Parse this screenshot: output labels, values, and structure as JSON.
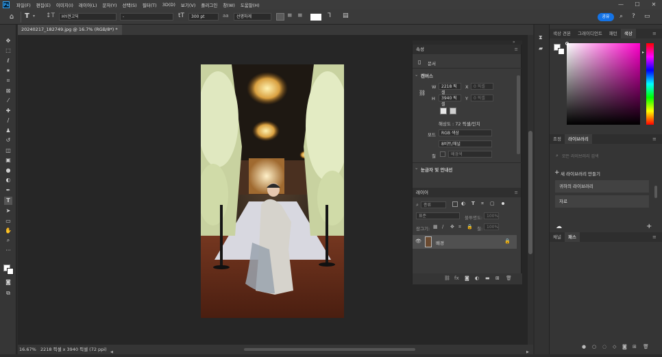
{
  "menubar": {
    "logo": "Ps",
    "items": [
      "파일(F)",
      "편집(E)",
      "이미지(I)",
      "레이어(L)",
      "문자(Y)",
      "선택(S)",
      "필터(T)",
      "3D(D)",
      "보기(V)",
      "플러그인",
      "창(W)",
      "도움말(H)"
    ]
  },
  "options": {
    "font_family": "HY견고딕",
    "font_style": "-",
    "font_size": "300 pt",
    "antialias": "선명하게",
    "share_label": "공유"
  },
  "document": {
    "tab_title": "20240217_182749.jpg @ 16.7% (RGB/8*) *",
    "zoom": "16.67%",
    "status": "2218 픽셀 x 3940 픽셀 (72 ppi)"
  },
  "properties": {
    "title": "속성",
    "doc_label": "문서",
    "canvas_section": "캔버스",
    "w_label": "W",
    "w_value": "2218 픽셀",
    "h_label": "H",
    "h_value": "3940 픽셀",
    "x_label": "X",
    "x_value": "0 픽셀",
    "y_label": "Y",
    "y_value": "0 픽셀",
    "resolution": "해상도 : 72 픽셀/인치",
    "mode_label": "모드",
    "mode_value": "RGB 색상",
    "depth_value": "8비트/채널",
    "fill_label": "칠",
    "fill_value": "배경색",
    "guides_section": "눈금자 및 안내선"
  },
  "layers": {
    "title": "레이어",
    "filter_kind": "종류",
    "blend_mode": "표준",
    "opacity_label": "불투명도:",
    "opacity_value": "100%",
    "lock_label": "잠그기:",
    "fill_label": "칠:",
    "fill_value": "100%",
    "rows": [
      {
        "name": "배경"
      }
    ]
  },
  "color_panel": {
    "tabs": [
      "색상 견본",
      "그레이디언트",
      "패턴",
      "색상"
    ],
    "active_tab": "색상",
    "hue_color": "#ff00cc"
  },
  "library_panel": {
    "tabs": [
      "조정",
      "라이브러리"
    ],
    "active_tab": "라이브러리",
    "search_placeholder": "모든 라이브러리 검색",
    "new_library": "새 라이브러리 만들기",
    "items": [
      "귀하의 라이브러리",
      "자료"
    ]
  },
  "paths_panel": {
    "tabs": [
      "채널",
      "패스"
    ],
    "active_tab": "패스"
  }
}
